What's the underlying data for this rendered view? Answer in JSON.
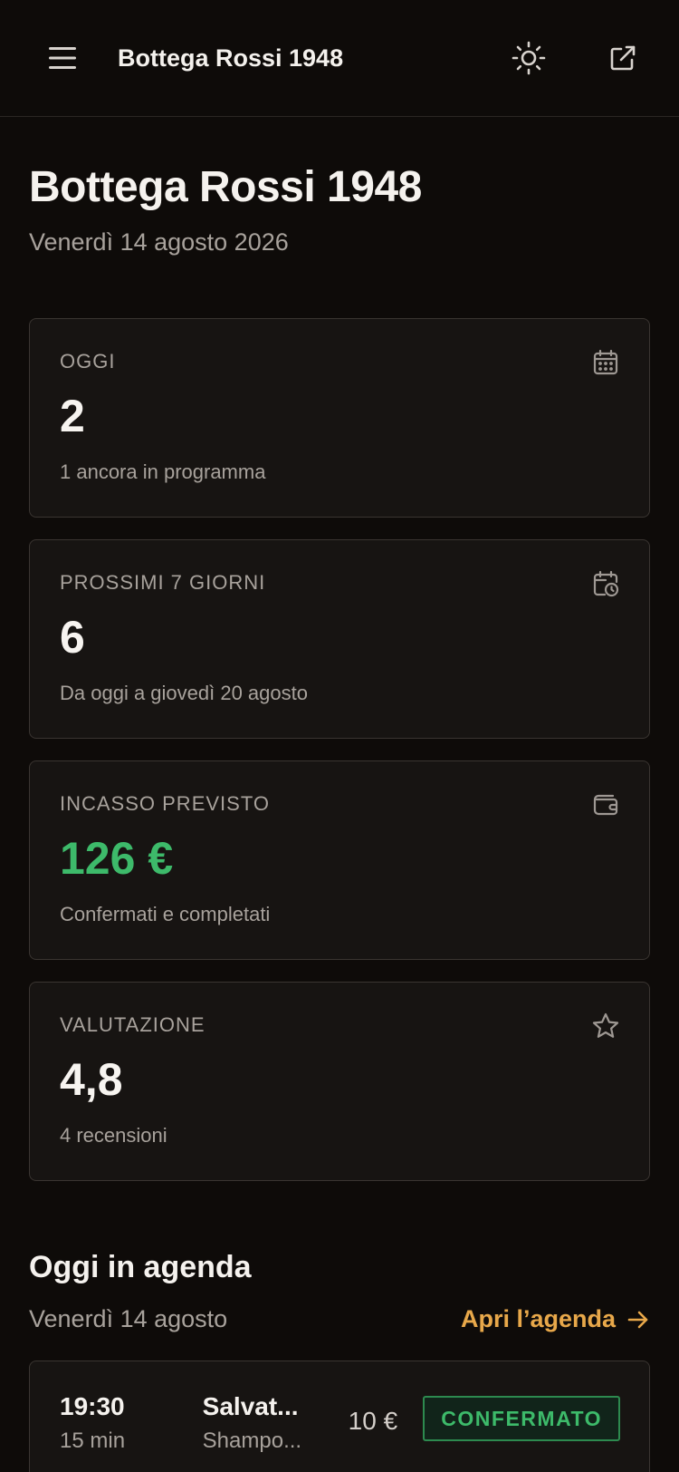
{
  "header": {
    "brand": "Bottega Rossi 1948"
  },
  "page": {
    "title": "Bottega Rossi 1948",
    "date": "Venerdì 14 agosto 2026"
  },
  "stats": [
    {
      "label": "OGGI",
      "value": "2",
      "sub": "1 ancora in programma",
      "icon": "calendar-icon"
    },
    {
      "label": "PROSSIMI 7 GIORNI",
      "value": "6",
      "sub": "Da oggi a giovedì 20 agosto",
      "icon": "calendar-clock-icon"
    },
    {
      "label": "INCASSO PREVISTO",
      "value": "126 €",
      "sub": "Confermati e completati",
      "icon": "wallet-icon",
      "accent": "#3dba6a"
    },
    {
      "label": "VALUTAZIONE",
      "value": "4,8",
      "sub": "4 recensioni",
      "icon": "star-icon"
    }
  ],
  "agenda": {
    "title": "Oggi in agenda",
    "date": "Venerdì 14 agosto",
    "link": "Apri l’agenda",
    "appointments": [
      {
        "time": "19:30",
        "duration": "15 min",
        "client": "Salvat...",
        "service": "Shampo...",
        "price": "10 €",
        "status": "CONFERMATO"
      }
    ]
  },
  "colors": {
    "background": "#0e0b09",
    "card": "#171412",
    "accent": "#e8a84a",
    "success": "#3dba6a"
  }
}
